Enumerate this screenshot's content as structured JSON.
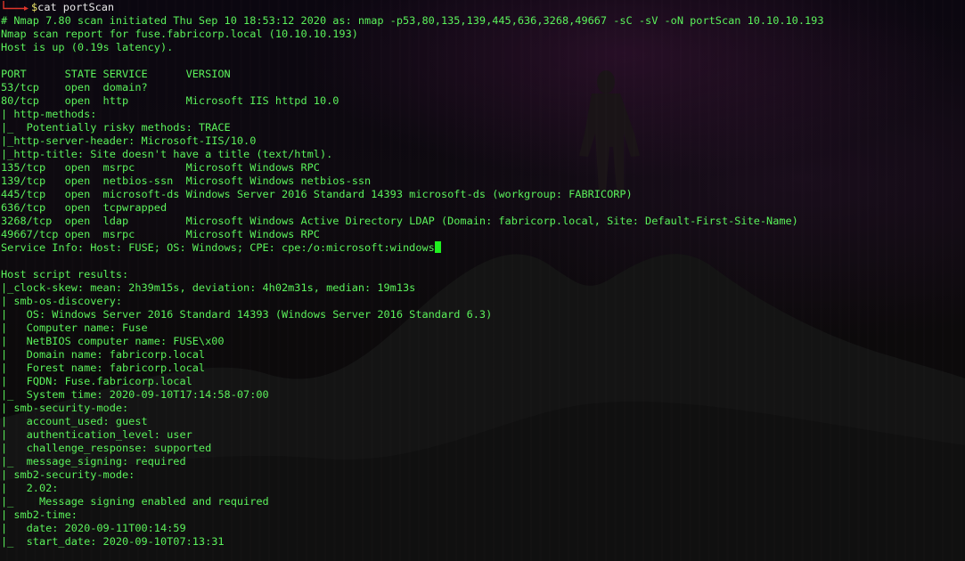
{
  "terminal": {
    "prompt_symbol": "$",
    "prompt_command": "cat portScan",
    "lines": [
      "# Nmap 7.80 scan initiated Thu Sep 10 18:53:12 2020 as: nmap -p53,80,135,139,445,636,3268,49667 -sC -sV -oN portScan 10.10.10.193",
      "Nmap scan report for fuse.fabricorp.local (10.10.10.193)",
      "Host is up (0.19s latency).",
      "",
      "PORT      STATE SERVICE      VERSION",
      "53/tcp    open  domain?",
      "80/tcp    open  http         Microsoft IIS httpd 10.0",
      "| http-methods: ",
      "|_  Potentially risky methods: TRACE",
      "|_http-server-header: Microsoft-IIS/10.0",
      "|_http-title: Site doesn't have a title (text/html).",
      "135/tcp   open  msrpc        Microsoft Windows RPC",
      "139/tcp   open  netbios-ssn  Microsoft Windows netbios-ssn",
      "445/tcp   open  microsoft-ds Windows Server 2016 Standard 14393 microsoft-ds (workgroup: FABRICORP)",
      "636/tcp   open  tcpwrapped",
      "3268/tcp  open  ldap         Microsoft Windows Active Directory LDAP (Domain: fabricorp.local, Site: Default-First-Site-Name)",
      "49667/tcp open  msrpc        Microsoft Windows RPC",
      "Service Info: Host: FUSE; OS: Windows; CPE: cpe:/o:microsoft:windows",
      "",
      "Host script results:",
      "|_clock-skew: mean: 2h39m15s, deviation: 4h02m31s, median: 19m13s",
      "| smb-os-discovery: ",
      "|   OS: Windows Server 2016 Standard 14393 (Windows Server 2016 Standard 6.3)",
      "|   Computer name: Fuse",
      "|   NetBIOS computer name: FUSE\\x00",
      "|   Domain name: fabricorp.local",
      "|   Forest name: fabricorp.local",
      "|   FQDN: Fuse.fabricorp.local",
      "|_  System time: 2020-09-10T17:14:58-07:00",
      "| smb-security-mode: ",
      "|   account_used: guest",
      "|   authentication_level: user",
      "|   challenge_response: supported",
      "|_  message_signing: required",
      "| smb2-security-mode: ",
      "|   2.02: ",
      "|_    Message signing enabled and required",
      "| smb2-time: ",
      "|   date: 2020-09-11T00:14:59",
      "|_  start_date: 2020-09-10T07:13:31"
    ]
  },
  "colors": {
    "output_text": "#5bf25b",
    "prompt_arrow": "#e0352b",
    "prompt_dollar": "#f0e96b",
    "prompt_text": "#e8e8e8",
    "cursor": "#1ff01f"
  }
}
